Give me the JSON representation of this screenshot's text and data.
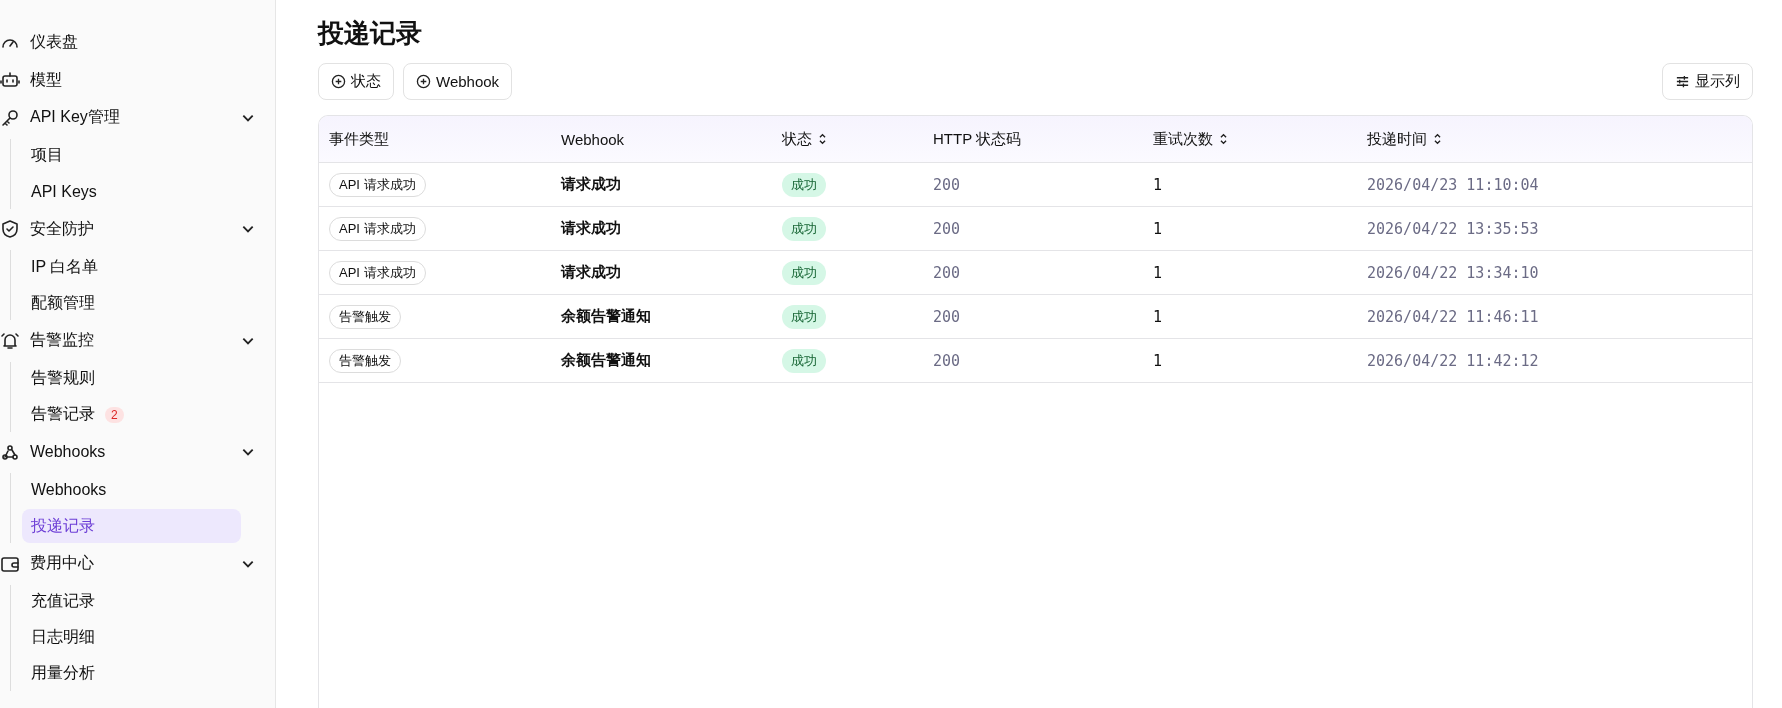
{
  "sidebar": {
    "items": [
      {
        "kind": "item",
        "label": "仪表盘",
        "selected": false
      },
      {
        "kind": "item",
        "label": "模型",
        "selected": false
      },
      {
        "kind": "group",
        "label": "API Key管理",
        "expanded": true,
        "children": [
          {
            "label": "项目",
            "selected": false
          },
          {
            "label": "API Keys",
            "selected": false
          }
        ]
      },
      {
        "kind": "group",
        "label": "安全防护",
        "expanded": true,
        "children": [
          {
            "label": "IP 白名单",
            "selected": false
          },
          {
            "label": "配额管理",
            "selected": false
          }
        ]
      },
      {
        "kind": "group",
        "label": "告警监控",
        "expanded": true,
        "children": [
          {
            "label": "告警规则",
            "selected": false
          },
          {
            "label": "告警记录",
            "selected": false,
            "badge": "2"
          }
        ]
      },
      {
        "kind": "group",
        "label": "Webhooks",
        "expanded": true,
        "children": [
          {
            "label": "Webhooks",
            "selected": false
          },
          {
            "label": "投递记录",
            "selected": true
          }
        ]
      },
      {
        "kind": "group",
        "label": "费用中心",
        "expanded": true,
        "children": [
          {
            "label": "充值记录",
            "selected": false
          },
          {
            "label": "日志明细",
            "selected": false
          },
          {
            "label": "用量分析",
            "selected": false
          }
        ]
      }
    ]
  },
  "page_title": "投递记录",
  "filters": [
    "状态",
    "Webhook"
  ],
  "columns_button": "显示列",
  "table": {
    "columns": [
      {
        "label": "事件类型",
        "sortable": false
      },
      {
        "label": "Webhook",
        "sortable": false
      },
      {
        "label": "状态",
        "sortable": true
      },
      {
        "label": "HTTP 状态码",
        "sortable": false
      },
      {
        "label": "重试次数",
        "sortable": true
      },
      {
        "label": "投递时间",
        "sortable": true
      }
    ],
    "rows": [
      {
        "event": "API 请求成功",
        "webhook": "请求成功",
        "status": {
          "label": "成功",
          "kind": "success"
        },
        "http": "200",
        "retries": "1",
        "time": "2026/04/23 11:10:04"
      },
      {
        "event": "API 请求成功",
        "webhook": "请求成功",
        "status": {
          "label": "成功",
          "kind": "success"
        },
        "http": "200",
        "retries": "1",
        "time": "2026/04/22 13:35:53"
      },
      {
        "event": "API 请求成功",
        "webhook": "请求成功",
        "status": {
          "label": "成功",
          "kind": "success"
        },
        "http": "200",
        "retries": "1",
        "time": "2026/04/22 13:34:10"
      },
      {
        "event": "告警触发",
        "webhook": "余额告警通知",
        "status": {
          "label": "成功",
          "kind": "success"
        },
        "http": "200",
        "retries": "1",
        "time": "2026/04/22 11:46:11"
      },
      {
        "event": "告警触发",
        "webhook": "余额告警通知",
        "status": {
          "label": "成功",
          "kind": "success"
        },
        "http": "200",
        "retries": "1",
        "time": "2026/04/22 11:42:12"
      }
    ]
  }
}
